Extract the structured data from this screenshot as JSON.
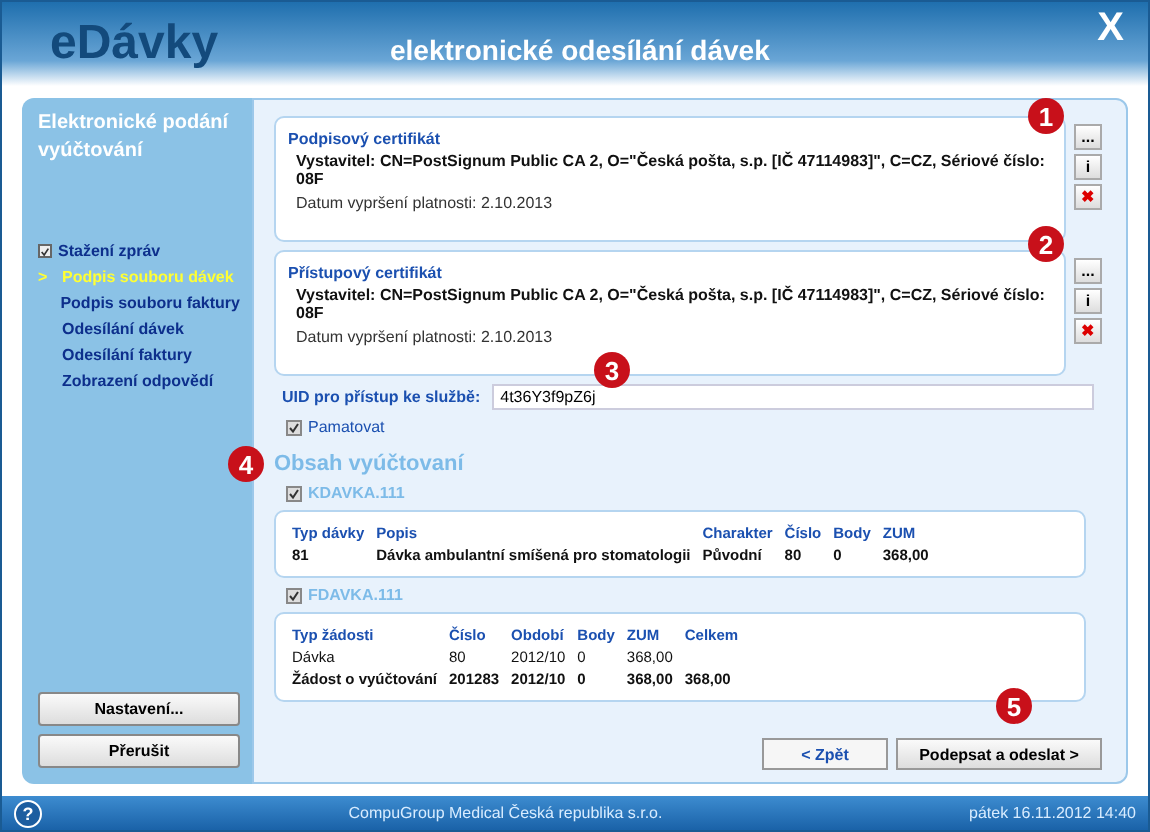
{
  "header": {
    "logo": "eDávky",
    "title": "elektronické odesílání dávek",
    "close": "X"
  },
  "sidebar": {
    "title": "Elektronické podání vyúčtování",
    "items": [
      {
        "label": "Stažení zpráv",
        "done": true,
        "selected": false,
        "marker": ""
      },
      {
        "label": "Podpis souboru dávek",
        "done": false,
        "selected": true,
        "marker": ">"
      },
      {
        "label": "Podpis souboru faktury",
        "done": false,
        "selected": false,
        "marker": ""
      },
      {
        "label": "Odesílání dávek",
        "done": false,
        "selected": false,
        "marker": ""
      },
      {
        "label": "Odesílání faktury",
        "done": false,
        "selected": false,
        "marker": ""
      },
      {
        "label": "Zobrazení odpovědí",
        "done": false,
        "selected": false,
        "marker": ""
      }
    ],
    "buttons": [
      "Nastavení...",
      "Přerušit"
    ]
  },
  "certificates": [
    {
      "title": "Podpisový certifikát",
      "issuer": "Vystavitel: CN=PostSignum Public CA 2, O=\"Česká pošta, s.p. [IČ 47114983]\", C=CZ, Sériové číslo: 08F",
      "expiry": "Datum vypršení platnosti: 2.10.2013",
      "buttons": [
        "...",
        "i",
        "✖"
      ]
    },
    {
      "title": "Přístupový certifikát",
      "issuer": "Vystavitel: CN=PostSignum Public CA 2, O=\"Česká pošta, s.p. [IČ 47114983]\", C=CZ, Sériové číslo: 08F",
      "expiry": "Datum vypršení platnosti: 2.10.2013",
      "buttons": [
        "...",
        "i",
        "✖"
      ]
    }
  ],
  "uid": {
    "label": "UID pro přístup ke službě:",
    "value": "4t36Y3f9pZ6j"
  },
  "remember": {
    "label": "Pamatovat",
    "checked": true
  },
  "content": {
    "title": "Obsah vyúčtovaní",
    "files": [
      {
        "name": "KDAVKA.111",
        "checked": true,
        "columns": [
          "Typ dávky",
          "Popis",
          "Charakter",
          "Číslo",
          "Body",
          "ZUM"
        ],
        "rows": [
          {
            "bold": true,
            "cells": [
              "81",
              "Dávka ambulantní smíšená pro stomatologii",
              "Původní",
              "80",
              "0",
              "368,00"
            ]
          }
        ]
      },
      {
        "name": "FDAVKA.111",
        "checked": true,
        "columns": [
          "Typ žádosti",
          "Číslo",
          "Období",
          "Body",
          "ZUM",
          "Celkem"
        ],
        "rows": [
          {
            "bold": false,
            "cells": [
              "Dávka",
              "80",
              "2012/10",
              "0",
              "368,00",
              ""
            ]
          },
          {
            "bold": true,
            "cells": [
              "Žádost o vyúčtování",
              "201283",
              "2012/10",
              "0",
              "368,00",
              "368,00"
            ]
          }
        ]
      }
    ]
  },
  "nav": [
    {
      "label": "< Zpět",
      "primary": false
    },
    {
      "label": "Podepsat a odeslat >",
      "primary": true
    }
  ],
  "callouts": [
    "1",
    "2",
    "3",
    "4",
    "5"
  ],
  "status_bar": {
    "help": "?",
    "company": "CompuGroup Medical Česká republika s.r.o.",
    "datetime": "pátek 16.11.2012 14:40"
  }
}
